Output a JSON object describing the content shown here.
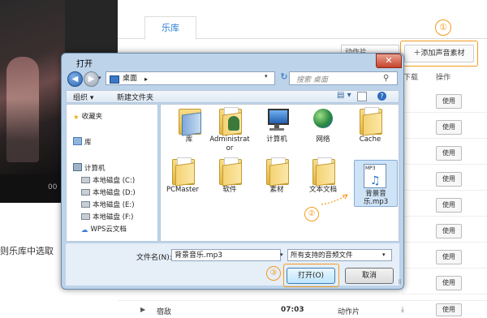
{
  "app": {
    "tab_music": "乐库",
    "add_sound_button": "添加声音素材",
    "badge1": "①",
    "sort_select": "动作片",
    "col_download": "下载",
    "col_action": "操作",
    "use_label": "使用",
    "left_text": "则乐库中选取",
    "video_time": "00",
    "bottom_row": {
      "name": "宿敌",
      "time": "07:03",
      "genre": "动作片",
      "use": "使用"
    }
  },
  "dialog": {
    "title": "打开",
    "close": "✕",
    "address": "桌面",
    "address_chevron": "▸",
    "search_placeholder": "搜索 桌面",
    "toolbar": {
      "organize": "组织 ▾",
      "new_folder": "新建文件夹",
      "view": "▤ ▾",
      "help": "?"
    },
    "nav": [
      {
        "label": "收藏夹",
        "icon": "star"
      },
      {
        "label": "库",
        "icon": "library"
      },
      {
        "label": "计算机",
        "icon": "computer"
      },
      {
        "label": "本地磁盘 (C:)",
        "icon": "disk"
      },
      {
        "label": "本地磁盘 (D:)",
        "icon": "disk"
      },
      {
        "label": "本地磁盘 (E:)",
        "icon": "disk"
      },
      {
        "label": "本地磁盘 (F:)",
        "icon": "disk"
      },
      {
        "label": "WPS云文档",
        "icon": "cloud"
      }
    ],
    "files": [
      {
        "label": "库",
        "icon": "library-folder"
      },
      {
        "label": "Administrator",
        "icon": "user-folder"
      },
      {
        "label": "计算机",
        "icon": "computer"
      },
      {
        "label": "网络",
        "icon": "network"
      },
      {
        "label": "Cache",
        "icon": "folder"
      },
      {
        "label": "PCMaster",
        "icon": "folder"
      },
      {
        "label": "软件",
        "icon": "folder"
      },
      {
        "label": "素材",
        "icon": "folder"
      },
      {
        "label": "文本文档",
        "icon": "folder"
      }
    ],
    "selected_file": {
      "tag": "MP3",
      "note": "♫",
      "label": "背景音乐.mp3"
    },
    "badge2": "②",
    "filename_label": "文件名(N):",
    "filename_value": "背景音乐.mp3",
    "filetype": "所有支持的音频文件",
    "open_button": "打开(O)",
    "cancel_button": "取消",
    "badge3": "③",
    "grip": "⠿"
  },
  "colors": {
    "accent": "#f39a1e",
    "link": "#2b7fd6",
    "dialog_frame": "#bcd3ea"
  }
}
